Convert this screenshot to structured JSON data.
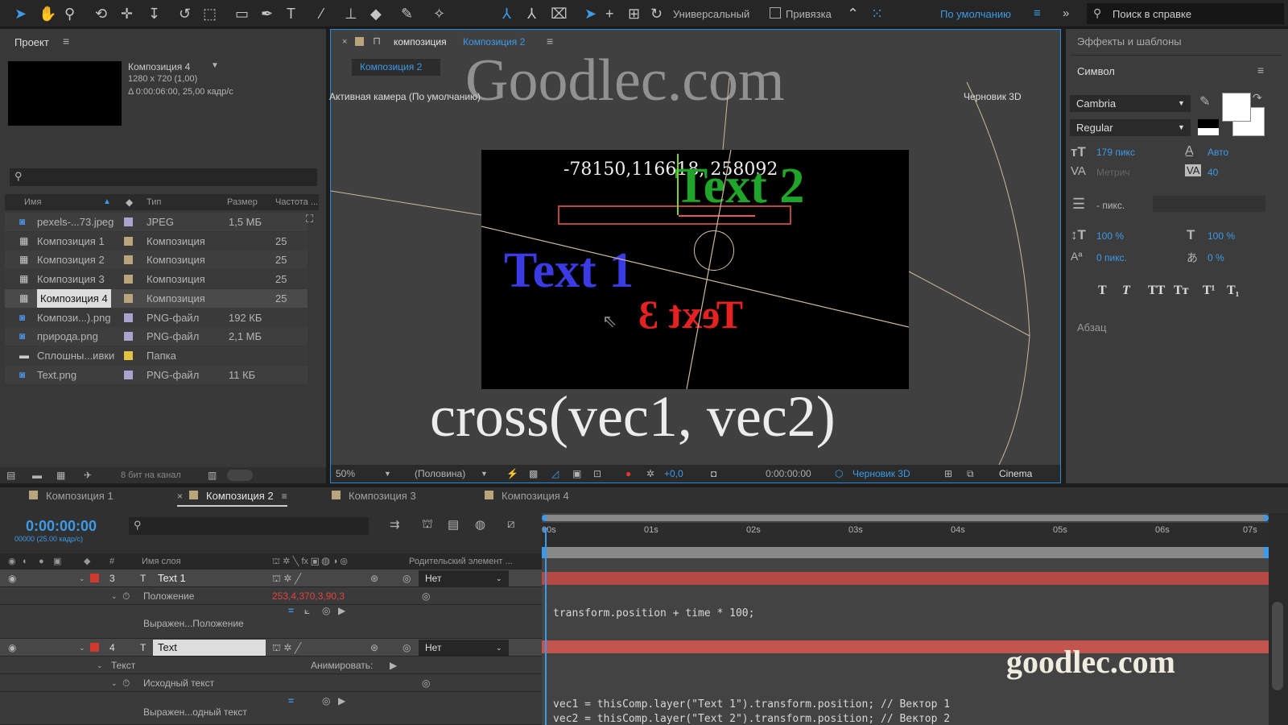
{
  "toolbar": {
    "workspace_mode": "Универсальный",
    "snap_label": "Привязка",
    "workspace": "По умолчанию",
    "search_placeholder": "Поиск в справке"
  },
  "project": {
    "title": "Проект",
    "selected_name": "Композиция 4",
    "selected_res": "1280 x 720 (1,00)",
    "selected_dur": "Δ 0:00:06:00, 25,00 кадр/с",
    "columns": [
      "Имя",
      "Тип",
      "Размер",
      "Частота ..."
    ],
    "items": [
      {
        "name": "pexels-...73.jpeg",
        "type": "JPEG",
        "size": "1,5 МБ",
        "rate": "",
        "color": "#a9a3cf",
        "icon": "image-file-icon"
      },
      {
        "name": "Композиция 1",
        "type": "Композиция",
        "size": "",
        "rate": "25",
        "color": "#b9a57c",
        "icon": "composition-icon"
      },
      {
        "name": "Композиция 2",
        "type": "Композиция",
        "size": "",
        "rate": "25",
        "color": "#b9a57c",
        "icon": "composition-icon"
      },
      {
        "name": "Композиция 3",
        "type": "Композиция",
        "size": "",
        "rate": "25",
        "color": "#b9a57c",
        "icon": "composition-icon"
      },
      {
        "name": "Композиция 4",
        "type": "Композиция",
        "size": "",
        "rate": "25",
        "color": "#b9a57c",
        "icon": "composition-icon"
      },
      {
        "name": "Компози...).png",
        "type": "PNG-файл",
        "size": "192 КБ",
        "rate": "",
        "color": "#a9a3cf",
        "icon": "image-file-icon"
      },
      {
        "name": "природа.png",
        "type": "PNG-файл",
        "size": "2,1 МБ",
        "rate": "",
        "color": "#a9a3cf",
        "icon": "image-file-icon"
      },
      {
        "name": "Сплошны...ивки",
        "type": "Папка",
        "size": "",
        "rate": "",
        "color": "#e0c341",
        "icon": "folder-icon"
      },
      {
        "name": "Text.png",
        "type": "PNG-файл",
        "size": "11 КБ",
        "rate": "",
        "color": "#a9a3cf",
        "icon": "image-file-icon"
      }
    ],
    "bit_depth": "8 бит на канал"
  },
  "viewer": {
    "tab_prefix": "композиция",
    "tab_name": "Композиция 2",
    "sub_tab": "Композиция 2",
    "camera": "Активная камера (По умолчанию)",
    "renderer": "Черновик 3D",
    "comp_readout": "-78150,116618, 258092",
    "text1": "Text 1",
    "text2": "Text 2",
    "text3": "Text 3",
    "zoom": "50%",
    "resolution": "(Половина)",
    "exposure": "+0,0",
    "timecode": "0:00:00:00",
    "draft3d": "Черновик 3D",
    "cinema": "Cinema"
  },
  "overlays": {
    "watermark_top": "Goodlec.com",
    "caption": "cross(vec1, vec2)",
    "watermark_bottom": "goodlec.com"
  },
  "character": {
    "effects_title": "Эффекты и шаблоны",
    "title": "Символ",
    "font": "Cambria",
    "style": "Regular",
    "size": "179 пикс",
    "leading": "Авто",
    "kerning": "Метрич",
    "tracking": "40",
    "stroke": "- пикс.",
    "vscale": "100 %",
    "hscale": "100 %",
    "baseline": "0 пикс.",
    "tsume": "0 %",
    "styles": [
      "T",
      "T",
      "TT",
      "Tт",
      "T¹",
      "T₁"
    ],
    "paragraph": "Абзац"
  },
  "timeline": {
    "tabs": [
      "Композиция 1",
      "Композиция 2",
      "Композиция 3",
      "Композиция 4"
    ],
    "active_tab": 1,
    "time": "0:00:00:00",
    "frames": "00000 (25.00 кадр/с)",
    "col_num": "#",
    "col_name": "Имя слоя",
    "col_parent": "Родительский элемент ...",
    "ruler": [
      "00s",
      "01s",
      "02s",
      "03s",
      "04s",
      "05s",
      "06s",
      "07s"
    ],
    "layer1": {
      "num": "3",
      "name": "Text 1",
      "parent": "Нет",
      "prop": "Положение",
      "value": "253,4,370,3,90,3",
      "expr_label": "Выражен...Положение",
      "expr": "transform.position + time * 100;"
    },
    "layer2": {
      "num": "4",
      "name": "Text",
      "parent": "Нет",
      "group": "Текст",
      "animate": "Анимировать:",
      "prop": "Исходный текст",
      "expr_label": "Выражен...одный текст",
      "expr1": "vec1 = thisComp.layer(\"Text 1\").transform.position;  // Вектор 1",
      "expr2": "vec2 = thisComp.layer(\"Text 2\").transform.position;  // Вектор 2"
    }
  }
}
